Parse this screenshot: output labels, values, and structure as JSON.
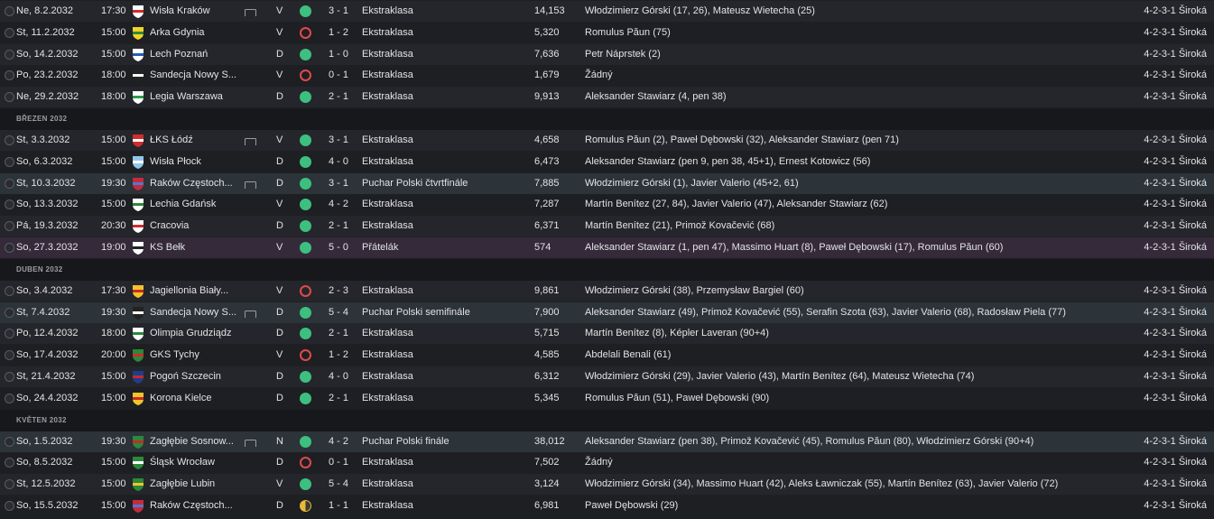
{
  "colors": {
    "win": "#3dbf80",
    "loss": "#e04a4a",
    "draw": "#e8b83a",
    "cup_row": "#2c3339",
    "friendly_row": "#342a3a"
  },
  "items": [
    {
      "kind": "match",
      "date": "Ne, 8.2.2032",
      "time": "17:30",
      "crest": "crest-wisla-krakow",
      "crest_colors": [
        "#ffffff",
        "#d22c2c"
      ],
      "opponent": "Wisła Kraków",
      "tv": true,
      "venue": "V",
      "result": "win",
      "score": "3 - 1",
      "competition": "Ekstraklasa",
      "attendance": "14,153",
      "scorers": "Włodzimierz Górski (17, 26), Mateusz Wietecha (25)",
      "formation": "4-2-3-1 Široká",
      "style": "alt"
    },
    {
      "kind": "match",
      "date": "St, 11.2.2032",
      "time": "15:00",
      "crest": "crest-arka-gdynia",
      "crest_colors": [
        "#f2d32b",
        "#2b8a3a"
      ],
      "opponent": "Arka Gdynia",
      "tv": false,
      "venue": "V",
      "result": "loss",
      "score": "1 - 2",
      "competition": "Ekstraklasa",
      "attendance": "5,320",
      "scorers": "Romulus Păun (75)",
      "formation": "4-2-3-1 Široká",
      "style": ""
    },
    {
      "kind": "match",
      "date": "So, 14.2.2032",
      "time": "15:00",
      "crest": "crest-lech-poznan",
      "crest_colors": [
        "#ffffff",
        "#2a5bb5"
      ],
      "opponent": "Lech Poznań",
      "tv": false,
      "venue": "D",
      "result": "win",
      "score": "1 - 0",
      "competition": "Ekstraklasa",
      "attendance": "7,636",
      "scorers": "Petr Náprstek (2)",
      "formation": "4-2-3-1 Široká",
      "style": "alt"
    },
    {
      "kind": "match",
      "date": "Po, 23.2.2032",
      "time": "18:00",
      "crest": "crest-sandecja",
      "crest_colors": [
        "#222222",
        "#ffffff"
      ],
      "opponent": "Sandecja Nowy S...",
      "tv": false,
      "venue": "V",
      "result": "loss",
      "score": "0 - 1",
      "competition": "Ekstraklasa",
      "attendance": "1,679",
      "scorers": "Žádný",
      "formation": "4-2-3-1 Široká",
      "style": ""
    },
    {
      "kind": "match",
      "date": "Ne, 29.2.2032",
      "time": "18:00",
      "crest": "crest-legia-warszawa",
      "crest_colors": [
        "#ffffff",
        "#2a9a4a"
      ],
      "opponent": "Legia Warszawa",
      "tv": false,
      "venue": "D",
      "result": "win",
      "score": "2 - 1",
      "competition": "Ekstraklasa",
      "attendance": "9,913",
      "scorers": "Aleksander Stawiarz (4, pen 38)",
      "formation": "4-2-3-1 Široká",
      "style": "alt"
    },
    {
      "kind": "month",
      "label": "BŘEZEN 2032"
    },
    {
      "kind": "match",
      "date": "St, 3.3.2032",
      "time": "15:00",
      "crest": "crest-lks-lodz",
      "crest_colors": [
        "#d22c2c",
        "#ffffff"
      ],
      "opponent": "ŁKS Łódź",
      "tv": true,
      "venue": "V",
      "result": "win",
      "score": "3 - 1",
      "competition": "Ekstraklasa",
      "attendance": "4,658",
      "scorers": "Romulus Păun (2), Paweł Dębowski (32), Aleksander Stawiarz (pen 71)",
      "formation": "4-2-3-1 Široká",
      "style": "alt"
    },
    {
      "kind": "match",
      "date": "So, 6.3.2032",
      "time": "15:00",
      "crest": "crest-wisla-plock",
      "crest_colors": [
        "#8fc8ee",
        "#ffffff"
      ],
      "opponent": "Wisła Płock",
      "tv": false,
      "venue": "D",
      "result": "win",
      "score": "4 - 0",
      "competition": "Ekstraklasa",
      "attendance": "6,473",
      "scorers": "Aleksander Stawiarz (pen 9, pen 38, 45+1), Ernest Kotowicz (56)",
      "formation": "4-2-3-1 Široká",
      "style": ""
    },
    {
      "kind": "match",
      "date": "St, 10.3.2032",
      "time": "19:30",
      "crest": "crest-rakow",
      "crest_colors": [
        "#c82a3a",
        "#4a7bd0"
      ],
      "opponent": "Raków Częstoch...",
      "tv": true,
      "venue": "D",
      "result": "win",
      "score": "3 - 1",
      "competition": "Puchar Polski čtvrtfinále",
      "attendance": "7,885",
      "scorers": "Włodzimierz Górski (1), Javier Valerio (45+2, 61)",
      "formation": "4-2-3-1 Široká",
      "style": "cup"
    },
    {
      "kind": "match",
      "date": "So, 13.3.2032",
      "time": "15:00",
      "crest": "crest-lechia-gdansk",
      "crest_colors": [
        "#ffffff",
        "#2a8a3a"
      ],
      "opponent": "Lechia Gdańsk",
      "tv": false,
      "venue": "V",
      "result": "win",
      "score": "4 - 2",
      "competition": "Ekstraklasa",
      "attendance": "7,287",
      "scorers": "Martín Benítez (27, 84), Javier Valerio (47), Aleksander Stawiarz (62)",
      "formation": "4-2-3-1 Široká",
      "style": ""
    },
    {
      "kind": "match",
      "date": "Pá, 19.3.2032",
      "time": "20:30",
      "crest": "crest-cracovia",
      "crest_colors": [
        "#ffffff",
        "#d22c2c"
      ],
      "opponent": "Cracovia",
      "tv": false,
      "venue": "D",
      "result": "win",
      "score": "2 - 1",
      "competition": "Ekstraklasa",
      "attendance": "6,371",
      "scorers": "Martín Benítez (21), Primož Kovačević (68)",
      "formation": "4-2-3-1 Široká",
      "style": "alt"
    },
    {
      "kind": "match",
      "date": "So, 27.3.2032",
      "time": "19:00",
      "crest": "crest-ks-belk",
      "crest_colors": [
        "#ffffff",
        "#222222"
      ],
      "opponent": "KS Bełk",
      "tv": false,
      "venue": "V",
      "result": "win",
      "score": "5 - 0",
      "competition": "Přátelák",
      "attendance": "574",
      "scorers": "Aleksander Stawiarz (1, pen 47), Massimo Huart (8), Paweł Dębowski (17), Romulus Păun (60)",
      "formation": "4-2-3-1 Široká",
      "style": "friendly"
    },
    {
      "kind": "month",
      "label": "DUBEN 2032"
    },
    {
      "kind": "match",
      "date": "So, 3.4.2032",
      "time": "17:30",
      "crest": "crest-jagiellonia",
      "crest_colors": [
        "#f2c42b",
        "#c82a2a"
      ],
      "opponent": "Jagiellonia Biały...",
      "tv": false,
      "venue": "V",
      "result": "loss",
      "score": "2 - 3",
      "competition": "Ekstraklasa",
      "attendance": "9,861",
      "scorers": "Włodzimierz Górski (38), Przemysław Bargiel (60)",
      "formation": "4-2-3-1 Široká",
      "style": "alt"
    },
    {
      "kind": "match",
      "date": "St, 7.4.2032",
      "time": "19:30",
      "crest": "crest-sandecja",
      "crest_colors": [
        "#222222",
        "#ffffff"
      ],
      "opponent": "Sandecja Nowy S...",
      "tv": true,
      "venue": "D",
      "result": "win",
      "score": "5 - 4",
      "competition": "Puchar Polski semifinále",
      "attendance": "7,900",
      "scorers": "Aleksander Stawiarz (49), Primož Kovačević (55), Serafin Szota (63), Javier Valerio (68), Radosław Piela (77)",
      "formation": "4-2-3-1 Široká",
      "style": "cup"
    },
    {
      "kind": "match",
      "date": "Po, 12.4.2032",
      "time": "18:00",
      "crest": "crest-olimpia",
      "crest_colors": [
        "#ffffff",
        "#2a8a3a"
      ],
      "opponent": "Olimpia Grudziądz",
      "tv": false,
      "venue": "D",
      "result": "win",
      "score": "2 - 1",
      "competition": "Ekstraklasa",
      "attendance": "5,715",
      "scorers": "Martín Benítez (8), Képler Laveran (90+4)",
      "formation": "4-2-3-1 Široká",
      "style": "alt"
    },
    {
      "kind": "match",
      "date": "So, 17.4.2032",
      "time": "20:00",
      "crest": "crest-gks-tychy",
      "crest_colors": [
        "#2a8a3a",
        "#d22c2c"
      ],
      "opponent": "GKS Tychy",
      "tv": false,
      "venue": "V",
      "result": "loss",
      "score": "1 - 2",
      "competition": "Ekstraklasa",
      "attendance": "4,585",
      "scorers": "Abdelali Benali (61)",
      "formation": "4-2-3-1 Široká",
      "style": ""
    },
    {
      "kind": "match",
      "date": "St, 21.4.2032",
      "time": "15:00",
      "crest": "crest-pogon",
      "crest_colors": [
        "#1f3d8a",
        "#c82a2a"
      ],
      "opponent": "Pogoń Szczecin",
      "tv": false,
      "venue": "D",
      "result": "win",
      "score": "4 - 0",
      "competition": "Ekstraklasa",
      "attendance": "6,312",
      "scorers": "Włodzimierz Górski (29), Javier Valerio (43), Martín Benítez (64), Mateusz Wietecha (74)",
      "formation": "4-2-3-1 Široká",
      "style": "alt"
    },
    {
      "kind": "match",
      "date": "So, 24.4.2032",
      "time": "15:00",
      "crest": "crest-korona",
      "crest_colors": [
        "#f2c42b",
        "#c82a2a"
      ],
      "opponent": "Korona Kielce",
      "tv": false,
      "venue": "D",
      "result": "win",
      "score": "2 - 1",
      "competition": "Ekstraklasa",
      "attendance": "5,345",
      "scorers": "Romulus Păun (51), Paweł Dębowski (90)",
      "formation": "4-2-3-1 Široká",
      "style": ""
    },
    {
      "kind": "month",
      "label": "KVĚTEN 2032"
    },
    {
      "kind": "match",
      "date": "So, 1.5.2032",
      "time": "19:30",
      "crest": "crest-zaglebie-sosnowiec",
      "crest_colors": [
        "#2a8a3a",
        "#c82a2a"
      ],
      "opponent": "Zagłębie Sosnow...",
      "tv": true,
      "venue": "N",
      "result": "win",
      "score": "4 - 2",
      "competition": "Puchar Polski finále",
      "attendance": "38,012",
      "scorers": "Aleksander Stawiarz (pen 38), Primož Kovačević (45), Romulus Păun (80), Włodzimierz Górski (90+4)",
      "formation": "4-2-3-1 Široká",
      "style": "cup"
    },
    {
      "kind": "match",
      "date": "So, 8.5.2032",
      "time": "15:00",
      "crest": "crest-slask",
      "crest_colors": [
        "#2a8a3a",
        "#ffffff"
      ],
      "opponent": "Śląsk Wrocław",
      "tv": false,
      "venue": "D",
      "result": "loss",
      "score": "0 - 1",
      "competition": "Ekstraklasa",
      "attendance": "7,502",
      "scorers": "Žádný",
      "formation": "4-2-3-1 Široká",
      "style": ""
    },
    {
      "kind": "match",
      "date": "St, 12.5.2032",
      "time": "15:00",
      "crest": "crest-zaglebie-lubin",
      "crest_colors": [
        "#2a8a3a",
        "#f2c42b"
      ],
      "opponent": "Zagłębie Lubin",
      "tv": false,
      "venue": "V",
      "result": "win",
      "score": "5 - 4",
      "competition": "Ekstraklasa",
      "attendance": "3,124",
      "scorers": "Włodzimierz Górski (34), Massimo Huart (42), Aleks Ławniczak (55), Martín Benítez (63), Javier Valerio (72)",
      "formation": "4-2-3-1 Široká",
      "style": "alt"
    },
    {
      "kind": "match",
      "date": "So, 15.5.2032",
      "time": "15:00",
      "crest": "crest-rakow",
      "crest_colors": [
        "#c82a3a",
        "#4a7bd0"
      ],
      "opponent": "Raków Częstoch...",
      "tv": false,
      "venue": "D",
      "result": "draw",
      "score": "1 - 1",
      "competition": "Ekstraklasa",
      "attendance": "6,981",
      "scorers": "Paweł Dębowski (29)",
      "formation": "4-2-3-1 Široká",
      "style": ""
    }
  ]
}
